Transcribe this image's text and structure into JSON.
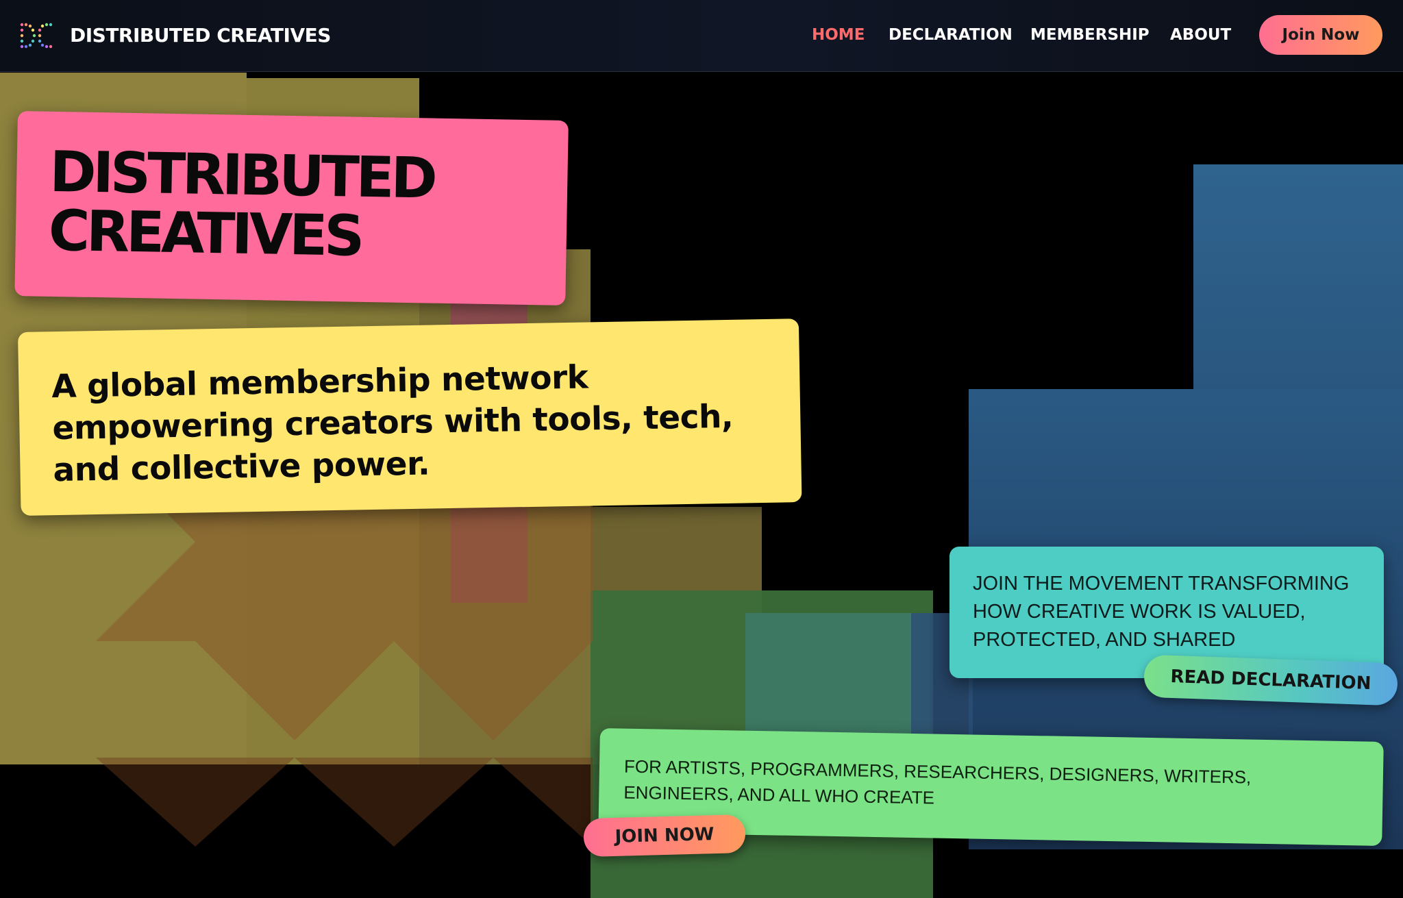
{
  "header": {
    "brand": "DISTRIBUTED CREATIVES",
    "nav": [
      "HOME",
      "DECLARATION",
      "MEMBERSHIP",
      "ABOUT"
    ],
    "active_nav": "HOME",
    "cta": "Join Now"
  },
  "hero": {
    "title_line1": "DISTRIBUTED",
    "title_line2": "CREATIVES",
    "tagline": "A global membership network empowering creators with tools, tech, and collective power."
  },
  "movement": {
    "text": "JOIN THE MOVEMENT TRANSFORMING HOW CREATIVE WORK IS VALUED, PROTECTED, AND SHARED",
    "button": "READ DECLARATION"
  },
  "audience": {
    "text": "FOR ARTISTS, PROGRAMMERS, RESEARCHERS, DESIGNERS, WRITERS, ENGINEERS, AND ALL WHO CREATE",
    "button": "JOIN NOW"
  },
  "colors": {
    "pink": "#ff6b9a",
    "yellow": "#ffe66e",
    "teal": "#4ecdc4",
    "green": "#7be385",
    "accent": "#ff6b6b"
  },
  "icons": [
    "dc-logo-icon"
  ]
}
